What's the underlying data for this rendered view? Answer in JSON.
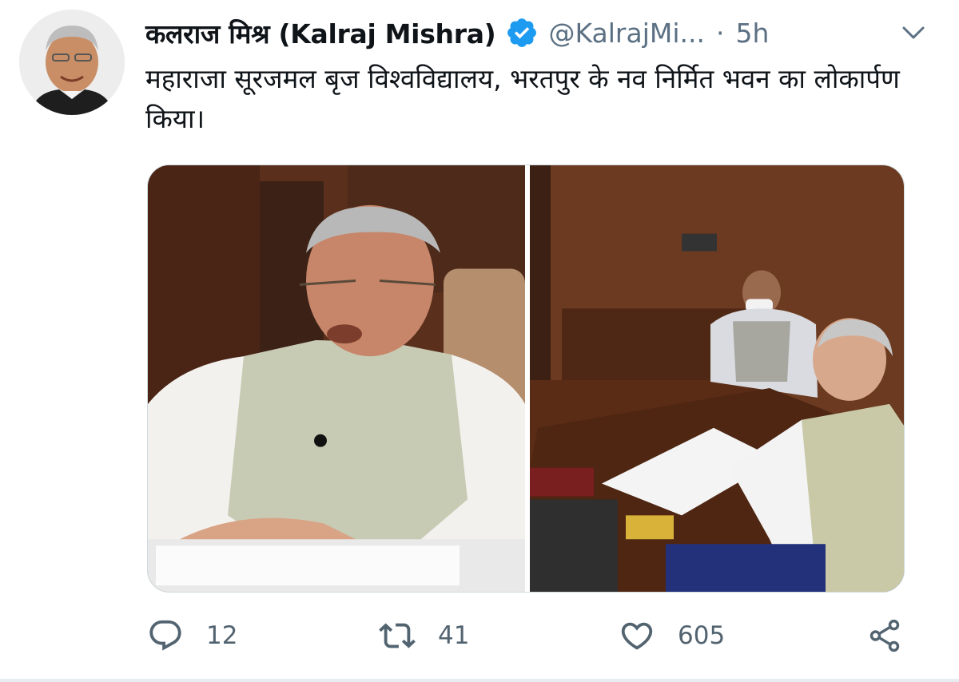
{
  "tweet": {
    "author": {
      "display_name": "कलराज मिश्र (Kalraj Mishra)",
      "handle": "@KalrajMi...",
      "verified": true,
      "avatar_icon": "profile-photo"
    },
    "separator": "·",
    "time": "5h",
    "text": "महाराजा सूरजमल बृज विश्वविद्यालय, भरतपुर के नव निर्मित भवन का लोकार्पण किया।",
    "media": [
      {
        "kind": "photo",
        "subject": "man in white kurta and grey vest speaking at desk"
      },
      {
        "kind": "photo",
        "subject": "meeting at office desk with masked official"
      }
    ],
    "actions": {
      "reply": {
        "icon": "reply-icon",
        "count": "12"
      },
      "retweet": {
        "icon": "retweet-icon",
        "count": "41"
      },
      "like": {
        "icon": "heart-icon",
        "count": "605"
      },
      "share": {
        "icon": "share-icon"
      }
    }
  },
  "colors": {
    "verified_blue": "#1d9bf0",
    "secondary_text": "#5b7083",
    "border": "#cfd9de"
  }
}
